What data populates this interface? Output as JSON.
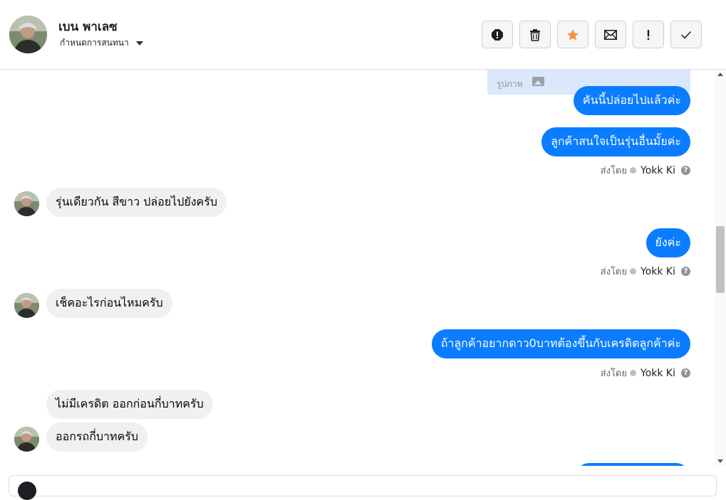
{
  "header": {
    "contact_name": "เบน พาเลซ",
    "assign_label": "กำหนดการสนทนา",
    "toolbar": [
      {
        "name": "spam-button",
        "icon": "octagon-alert-icon"
      },
      {
        "name": "delete-button",
        "icon": "trash-icon"
      },
      {
        "name": "star-button",
        "icon": "star-icon",
        "color": "#f7923b"
      },
      {
        "name": "mark-unread-button",
        "icon": "envelope-icon"
      },
      {
        "name": "follow-up-button",
        "icon": "exclamation-icon"
      },
      {
        "name": "done-button",
        "icon": "check-icon"
      }
    ]
  },
  "conversation": {
    "image_card": {
      "label": "รูปภาพ"
    },
    "messages": [
      {
        "direction": "out",
        "text": "คันนี้ปล่อยไปแล้วค่ะ"
      },
      {
        "direction": "out",
        "text": "ลูกค้าสนใจเป็นรุ่นอื่นมั้ยค่ะ"
      },
      {
        "direction": "in",
        "text": "รุ่นเดียวกัน สีขาว ปล่อยไปยังครับ"
      },
      {
        "direction": "out",
        "text": "ยังค่ะ"
      },
      {
        "direction": "in",
        "text": "เช็คอะไรก่อนไหมครับ"
      },
      {
        "direction": "out",
        "text": "ถ้าลูกค้าอยากดาว0บาทต้องขึ้นกับเครดิตลูกค้าค่ะ"
      },
      {
        "direction": "in",
        "text": "ไม่มีเครดิต ออกก่อนกี่บาทครับ"
      },
      {
        "direction": "in",
        "text": "ออกรถกี่บาทครับ"
      }
    ],
    "sent_by": {
      "prefix": "ส่งโดย",
      "agent": "Yokk Ki",
      "help": "?"
    }
  },
  "colors": {
    "outgoing": "#0a7cff",
    "incoming": "#f0f0f0",
    "star": "#f7923b"
  }
}
